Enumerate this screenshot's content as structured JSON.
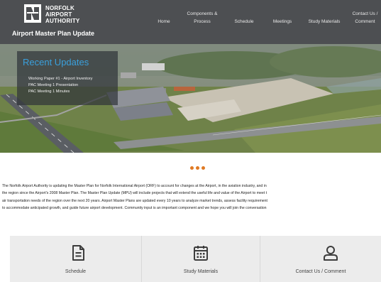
{
  "header": {
    "brand_lines": [
      "NORFOLK",
      "AIRPORT",
      "AUTHORITY"
    ],
    "subtitle": "Airport Master Plan Update",
    "nav": [
      {
        "line1": "Home",
        "line2": ""
      },
      {
        "line1": "Components &",
        "line2": "Process"
      },
      {
        "line1": "Schedule",
        "line2": ""
      },
      {
        "line1": "Meetings",
        "line2": ""
      },
      {
        "line1": "Study Materials",
        "line2": ""
      },
      {
        "line1": "Contact Us /",
        "line2": "Comment"
      }
    ]
  },
  "updates": {
    "title": "Recent Updates",
    "links": [
      "Working Paper #1 - Airport Inventory",
      "PAC Meeting 1 Presentation",
      "PAC Meeting 1 Minutes"
    ]
  },
  "intro_lines": [
    "The Norfolk Airport Authority is updating the Master Plan for Norfolk International Airport (ORF) to account for changes at the Airport, in the aviation industry, and in",
    "the region since the Airport's 2008 Master Plan. The Master Plan Update (MPU) will include projects that will extend the useful life and value of the Airport to meet t",
    "air transportation needs of the region over the next 20 years. Airport Master Plans are updated every 10 years to analyze market trends, assess facility requirement",
    "to accommodate anticipated growth, and guide future airport development. Community input is an important component and we hope you will join the conversation"
  ],
  "quick_links": [
    {
      "label": "Schedule",
      "icon": "document-icon"
    },
    {
      "label": "Study Materials",
      "icon": "calendar-icon"
    },
    {
      "label": "Contact Us / Comment",
      "icon": "user-icon"
    }
  ],
  "colors": {
    "header_bg": "#4d4f52",
    "updates_title": "#3aa0dc",
    "dots": "#e07a24",
    "quick_bg": "#ececec"
  }
}
